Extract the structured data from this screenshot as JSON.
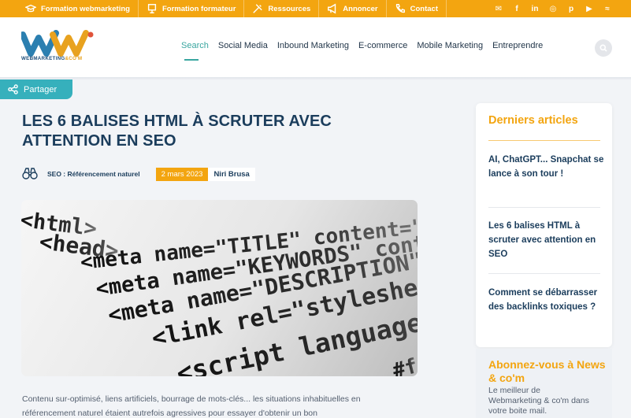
{
  "topbar": {
    "items": [
      {
        "label": "Formation webmarketing",
        "icon": "graduation-cap-icon"
      },
      {
        "label": "Formation formateur",
        "icon": "board-icon"
      },
      {
        "label": "Ressources",
        "icon": "tools-icon"
      },
      {
        "label": "Annoncer",
        "icon": "megaphone-icon"
      },
      {
        "label": "Contact",
        "icon": "phone-icon"
      }
    ],
    "social": [
      "newsletter-icon",
      "facebook-icon",
      "linkedin-icon",
      "twitter-icon",
      "pinterest-icon",
      "youtube-icon",
      "rss-icon"
    ],
    "color": "#f3a510"
  },
  "header": {
    "logo_text_main": "WEBMARKETING",
    "logo_text_accent": "&CO'M",
    "nav": [
      "Search",
      "Social Media",
      "Inbound Marketing",
      "E-commerce",
      "Mobile Marketing",
      "Entreprendre"
    ],
    "active_nav": "Search",
    "accent": "#3aa6a0"
  },
  "share": {
    "label": "Partager"
  },
  "article": {
    "title": "LES 6 BALISES HTML À SCRUTER AVEC ATTENTION EN SEO",
    "category": "SEO : Référencement naturel",
    "date": "2 mars 2023",
    "author": "Niri Brusa",
    "image_code": [
      "<html>",
      "<head>",
      "<meta name=\"TITLE\" content=\"",
      "<meta name=\"KEYWORDS\" conte",
      "<meta name=\"DESCRIPTION\" c",
      "<link rel=\"stylesheet\" t",
      "<script language=\"ja",
      "#f"
    ],
    "excerpt": "Contenu sur-optimisé, liens artificiels, bourrage de mots-clés... les situations inhabituelles en référencement naturel étaient autrefois agressives pour essayer d'obtenir un bon"
  },
  "sidebar": {
    "title": "Derniers articles",
    "articles": [
      "AI, ChatGPT... Snapchat se lance à son tour !",
      "Les 6 balises HTML à scruter avec attention en SEO",
      "Comment se débarrasser des backlinks toxiques ?"
    ]
  },
  "subscribe": {
    "title": "Abonnez-vous à News & co'm",
    "text": "Le meilleur de Webmarketing & co'm dans votre boite mail."
  }
}
